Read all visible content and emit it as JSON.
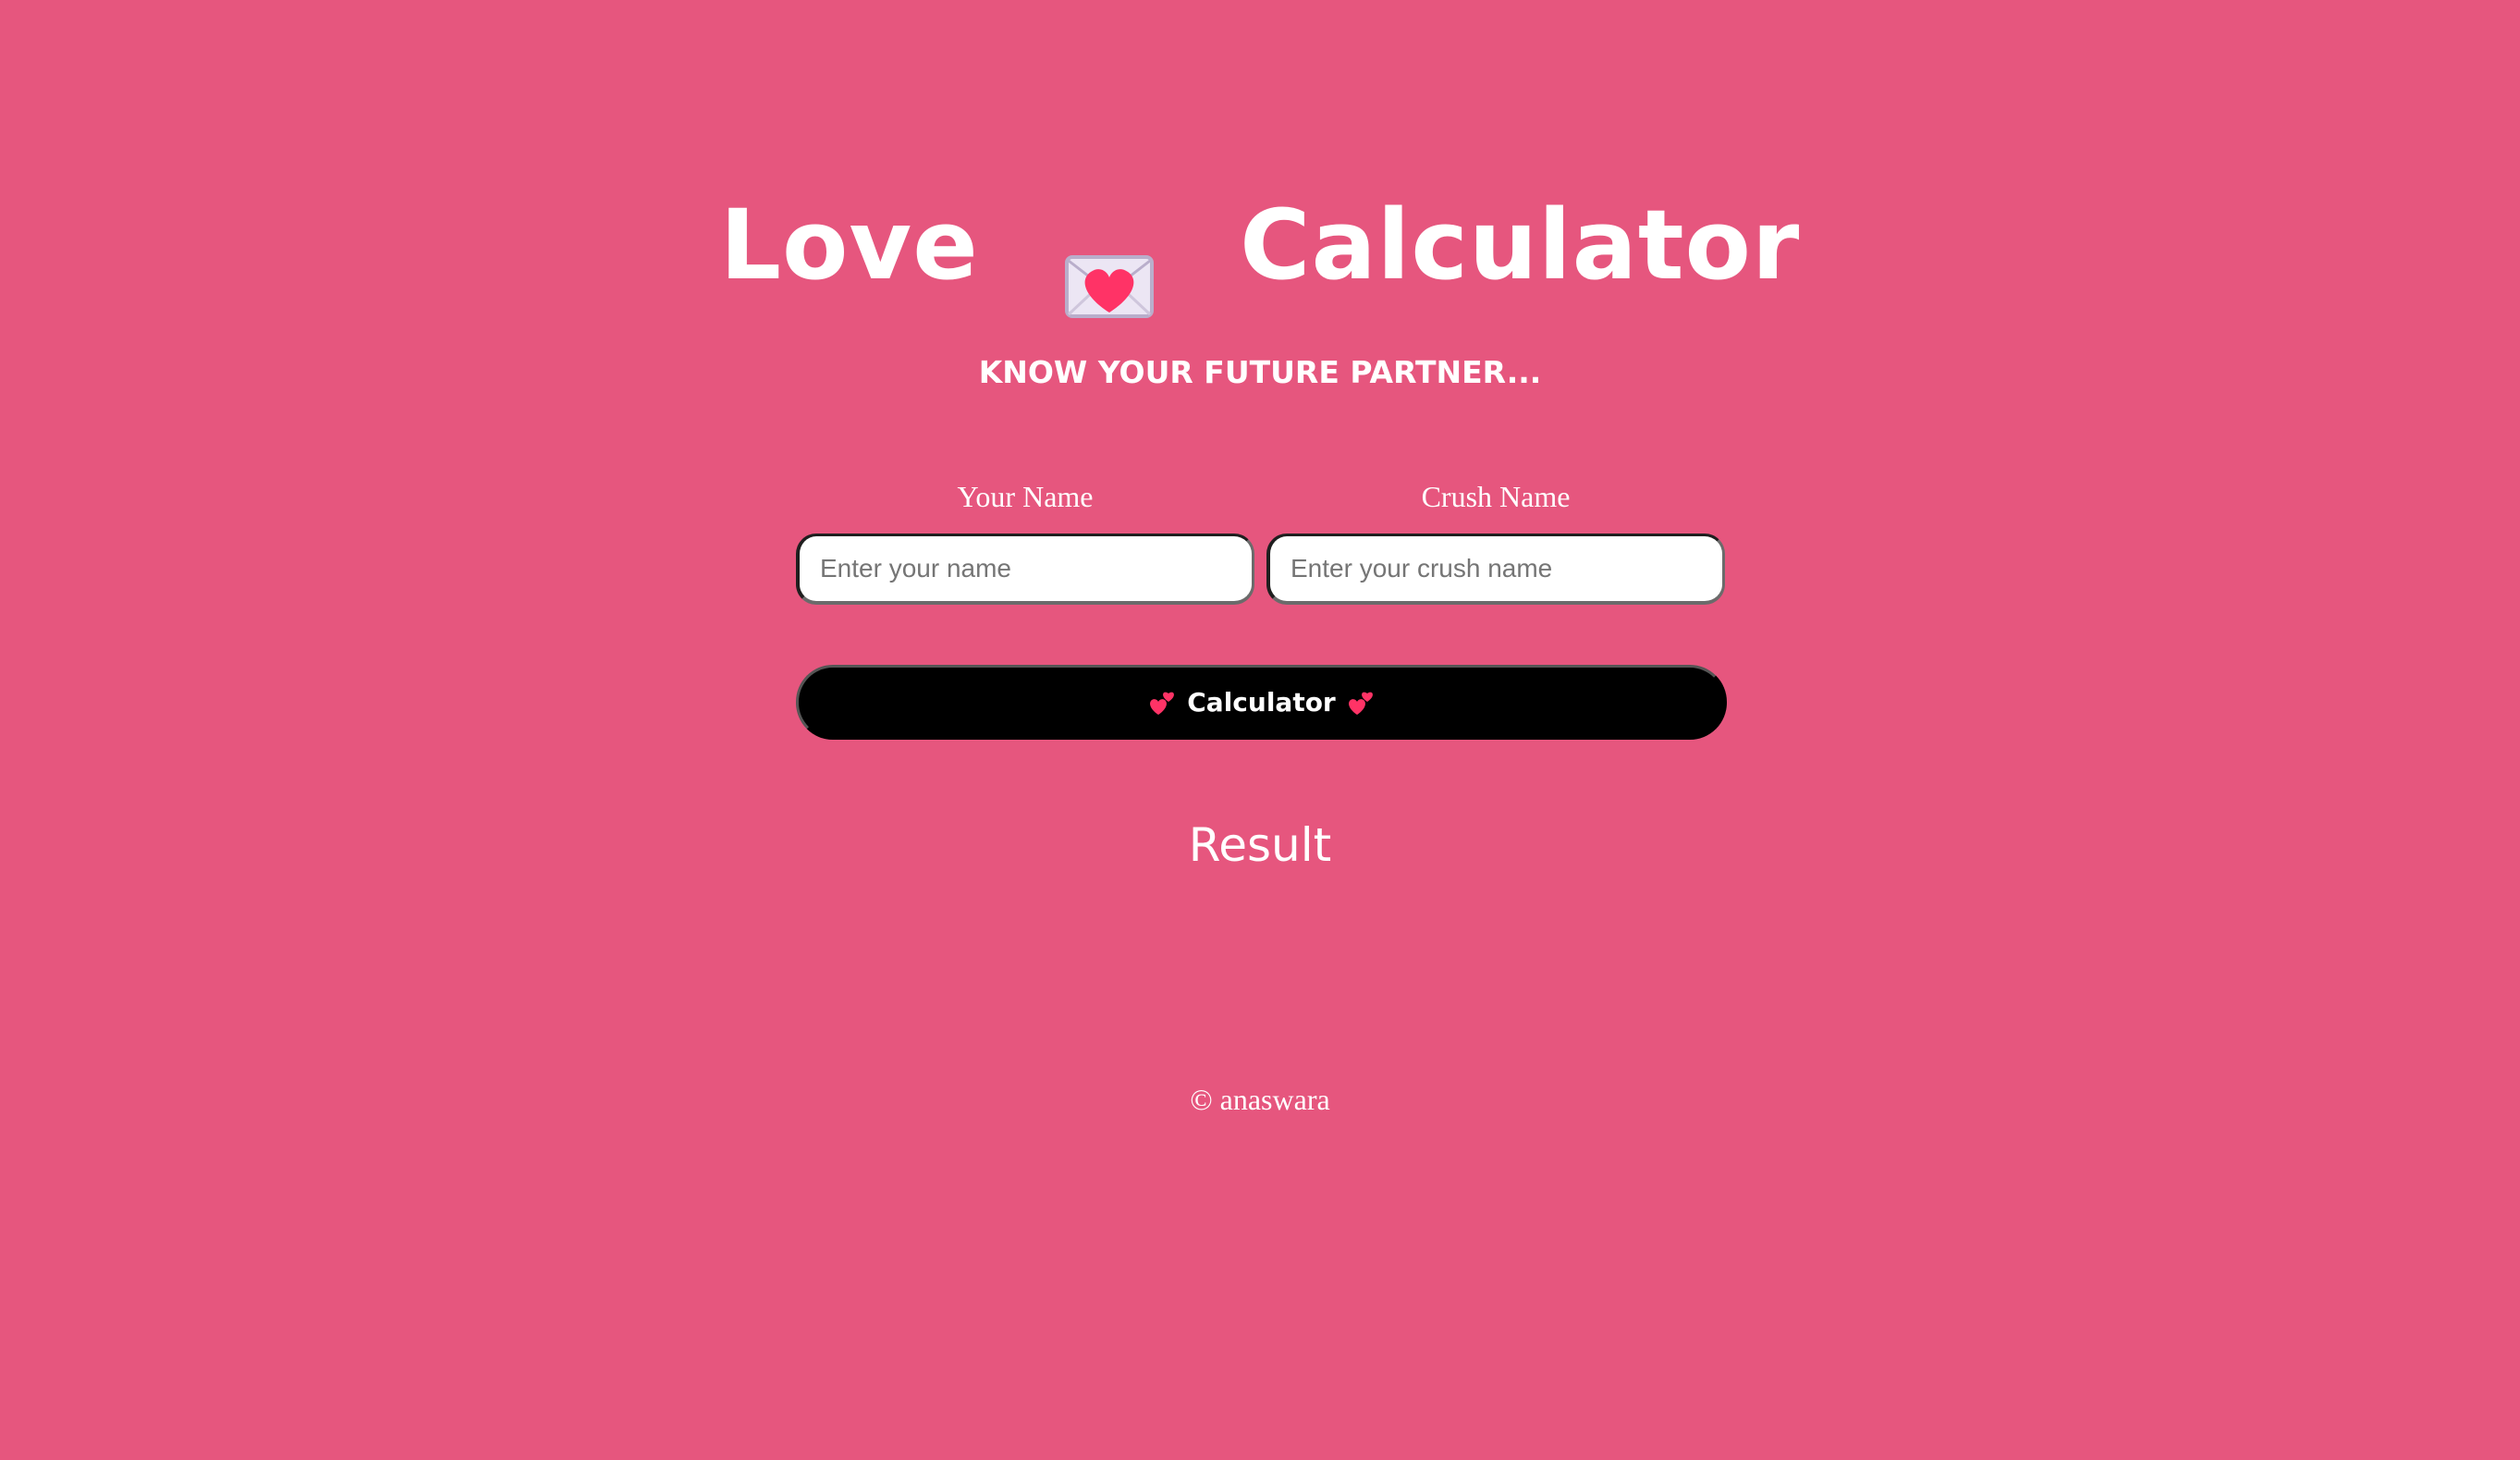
{
  "header": {
    "title_left": "Love",
    "title_icon": "love-letter-icon",
    "title_right": "Calculator",
    "subtitle": "KNOW YOUR FUTURE PARTNER..."
  },
  "form": {
    "your_name_label": "Your Name",
    "your_name_placeholder": "Enter your name",
    "your_name_value": "",
    "crush_name_label": "Crush Name",
    "crush_name_placeholder": "Enter your crush name",
    "crush_name_value": "",
    "button_label": "Calculator",
    "button_icon": "two-hearts-icon"
  },
  "result": {
    "label": "Result"
  },
  "footer": {
    "text": "© anaswara"
  },
  "colors": {
    "background": "#e6567e",
    "text": "#ffffff",
    "button": "#000000",
    "heart": "#ff3366"
  }
}
